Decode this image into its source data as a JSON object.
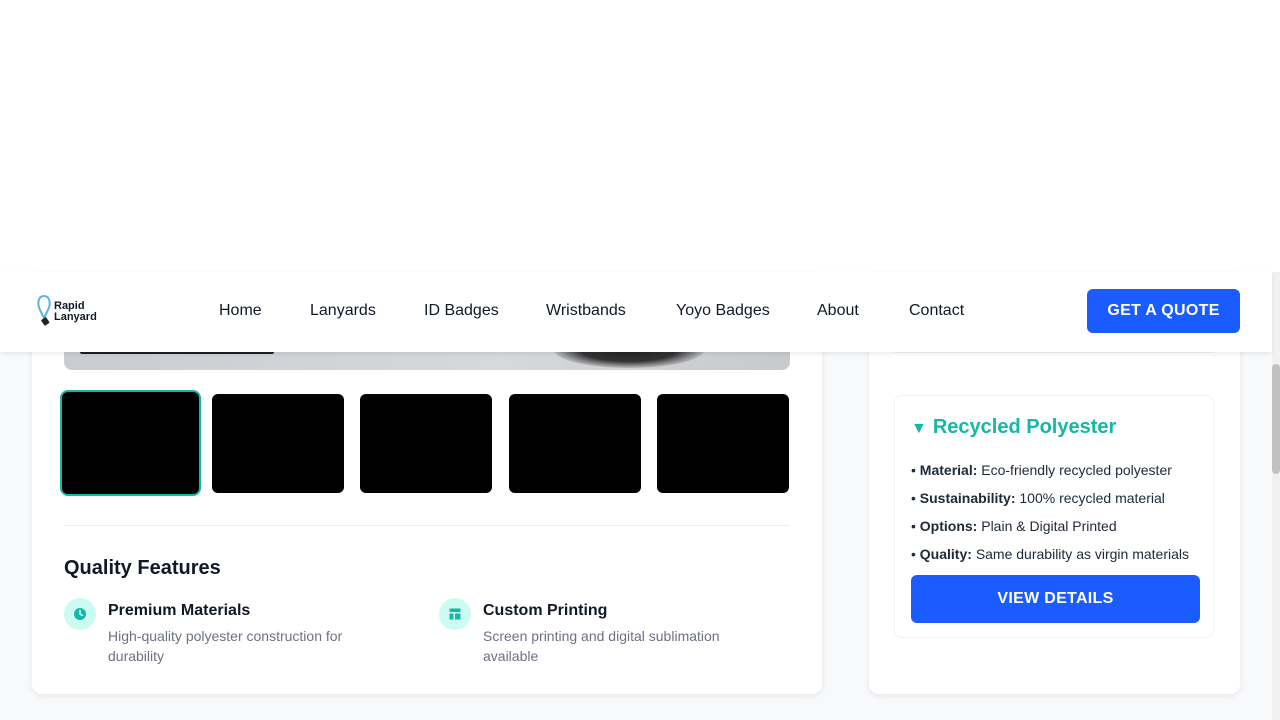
{
  "nav": {
    "logo_line1": "Rapid",
    "logo_line2": "Lanyard",
    "items": [
      "Home",
      "Lanyards",
      "ID Badges",
      "Wristbands",
      "Yoyo Badges",
      "About",
      "Contact"
    ],
    "cta": "GET A QUOTE"
  },
  "gallery": {
    "thumbnail_count": 5,
    "active_index": 0
  },
  "features": {
    "title": "Quality Features",
    "items": [
      {
        "title": "Premium Materials",
        "desc": "High-quality polyester construction for durability",
        "icon": "clock-icon"
      },
      {
        "title": "Custom Printing",
        "desc": "Screen printing and digital sublimation available",
        "icon": "layout-icon"
      }
    ]
  },
  "product": {
    "title": "Recycled Polyester",
    "bullets": [
      {
        "label": "Material:",
        "value": "Eco-friendly recycled polyester"
      },
      {
        "label": "Sustainability:",
        "value": "100% recycled material"
      },
      {
        "label": "Options:",
        "value": "Plain & Digital Printed"
      },
      {
        "label": "Quality:",
        "value": "Same durability as virgin materials"
      }
    ],
    "button": "VIEW DETAILS"
  },
  "colors": {
    "accent_teal": "#14b8a6",
    "primary_blue": "#1a5cff"
  }
}
